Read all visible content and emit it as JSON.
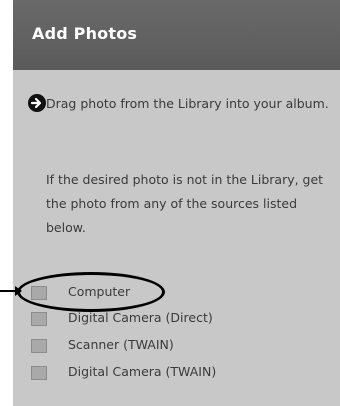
{
  "panel": {
    "title": "Add Photos",
    "instructions": [
      "Drag photo from the Library into your album.",
      "If the desired photo is not in the Library, get the photo from any of the sources listed below."
    ],
    "sources": [
      {
        "label": "Computer"
      },
      {
        "label": "Digital Camera (Direct)"
      },
      {
        "label": "Scanner (TWAIN)"
      },
      {
        "label": "Digital Camera (TWAIN)"
      }
    ]
  }
}
